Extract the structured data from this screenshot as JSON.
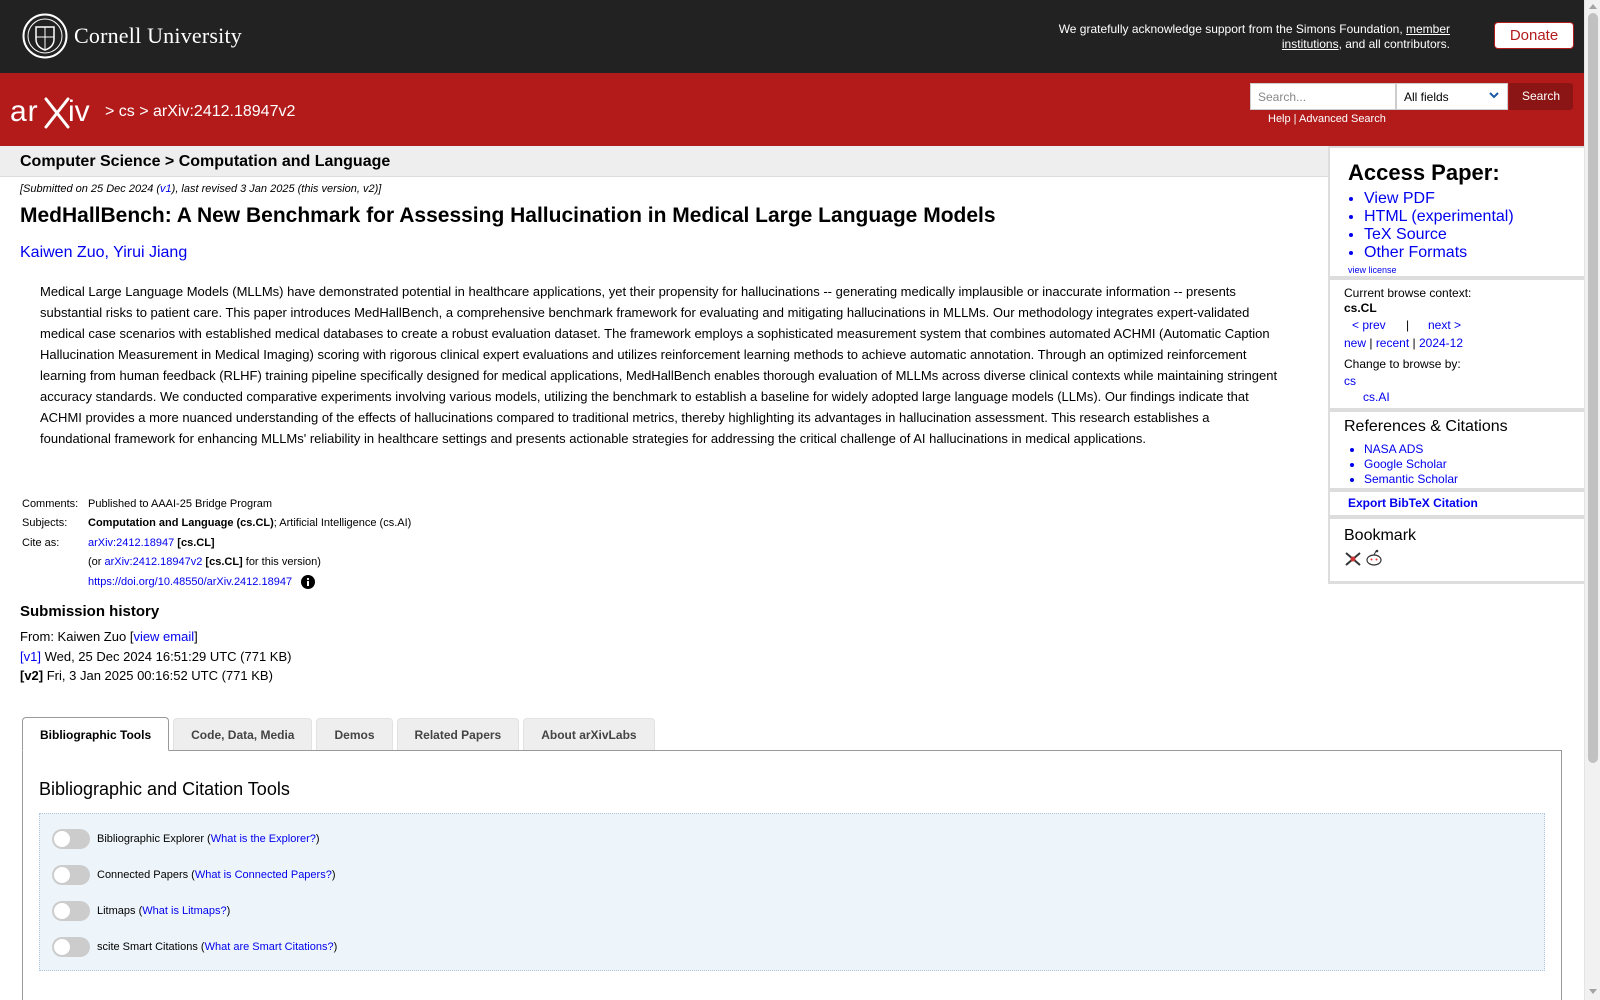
{
  "cornell": {
    "name": "Cornell University",
    "support_prefix": "We gratefully acknowledge support from the Simons Foundation, ",
    "support_link": "member institutions",
    "support_suffix": ", and all contributors.",
    "donate_label": "Donate"
  },
  "header": {
    "crumb_sep1": " > ",
    "crumb_cs": "cs",
    "crumb_sep2": " > ",
    "crumb_id": "arXiv:2412.18947v2",
    "search_placeholder": "Search...",
    "field_selected": "All fields",
    "search_label": "Search",
    "help_label": "Help",
    "help_sep": " | ",
    "advanced_label": "Advanced Search"
  },
  "subheader": "Computer Science > Computation and Language",
  "paper": {
    "dateline_a": "[Submitted on 25 Dec 2024 (",
    "dateline_v1": "v1",
    "dateline_b": "), last revised 3 Jan 2025 (this version, v2)]",
    "title": "MedHallBench: A New Benchmark for Assessing Hallucination in Medical Large Language Models",
    "author1": "Kaiwen Zuo",
    "author_sep": ", ",
    "author2": "Yirui Jiang",
    "abstract": "Medical Large Language Models (MLLMs) have demonstrated potential in healthcare applications, yet their propensity for hallucinations -- generating medically implausible or inaccurate information -- presents substantial risks to patient care. This paper introduces MedHallBench, a comprehensive benchmark framework for evaluating and mitigating hallucinations in MLLMs. Our methodology integrates expert-validated medical case scenarios with established medical databases to create a robust evaluation dataset. The framework employs a sophisticated measurement system that combines automated ACHMI (Automatic Caption Hallucination Measurement in Medical Imaging) scoring with rigorous clinical expert evaluations and utilizes reinforcement learning methods to achieve automatic annotation. Through an optimized reinforcement learning from human feedback (RLHF) training pipeline specifically designed for medical applications, MedHallBench enables thorough evaluation of MLLMs across diverse clinical contexts while maintaining stringent accuracy standards. We conducted comparative experiments involving various models, utilizing the benchmark to establish a baseline for widely adopted large language models (LLMs). Our findings indicate that ACHMI provides a more nuanced understanding of the effects of hallucinations compared to traditional metrics, thereby highlighting its advantages in hallucination assessment. This research establishes a foundational framework for enhancing MLLMs' reliability in healthcare settings and presents actionable strategies for addressing the critical challenge of AI hallucinations in medical applications."
  },
  "meta": {
    "comments_label": "Comments:",
    "comments_value": "Published to AAAI-25 Bridge Program",
    "subjects_label": "Subjects:",
    "subjects_primary": "Computation and Language (cs.CL)",
    "subjects_rest": "; Artificial Intelligence (cs.AI)",
    "cite_label": "Cite as:",
    "cite_id": "arXiv:2412.18947",
    "cite_cat": " [cs.CL]",
    "cite_or": "(or ",
    "cite_version": "arXiv:2412.18947v2",
    "cite_version_cat": " [cs.CL]",
    "cite_version_suffix": " for this version)",
    "doi": "https://doi.org/10.48550/arXiv.2412.18947"
  },
  "history": {
    "title": "Submission history",
    "from_prefix": "From: Kaiwen Zuo [",
    "view_email": "view email",
    "from_suffix": "]",
    "v1_label": "[v1]",
    "v1_text": " Wed, 25 Dec 2024 16:51:29 UTC (771 KB)",
    "v2_label": "[v2]",
    "v2_text": " Fri, 3 Jan 2025 00:16:52 UTC (771 KB)"
  },
  "tabs": [
    "Bibliographic Tools",
    "Code, Data, Media",
    "Demos",
    "Related Papers",
    "About arXivLabs"
  ],
  "tools": {
    "heading": "Bibliographic and Citation Tools",
    "items": [
      {
        "name": "Bibliographic Explorer",
        "link": "What is the Explorer?"
      },
      {
        "name": "Connected Papers",
        "link": "What is Connected Papers?"
      },
      {
        "name": "Litmaps",
        "link": "What is Litmaps?"
      },
      {
        "name": "scite Smart Citations",
        "link": "What are Smart Citations?"
      }
    ]
  },
  "sidebar": {
    "access_title": "Access Paper:",
    "access_links": [
      "View PDF",
      "HTML (experimental)",
      "TeX Source",
      "Other Formats"
    ],
    "view_license": "view license",
    "browse_context_label": "Current browse context:",
    "browse_context": "cs.CL",
    "prev": "< prev",
    "nav_sep": "|",
    "next": "next >",
    "new": "new",
    "recent": "recent",
    "month": "2024-12",
    "pipe": " | ",
    "change_browse": "Change to browse by:",
    "browse_cs": "cs",
    "browse_csai": "cs.AI",
    "refs_title": "References & Citations",
    "refs": [
      "NASA ADS",
      "Google Scholar",
      "Semantic Scholar"
    ],
    "export_bibtex": "Export BibTeX Citation",
    "bookmark_title": "Bookmark"
  },
  "icons": {
    "cornell_seal": "cornell-seal-icon",
    "arxiv_logo": "arxiv-logo",
    "chevron": "chevron-down-icon",
    "info": "info-icon",
    "bibsonomy": "bibsonomy-icon",
    "reddit": "reddit-icon"
  },
  "colors": {
    "arxiv_red": "#b31b1b",
    "dark_bar": "#222222",
    "link": "#0000ee"
  }
}
